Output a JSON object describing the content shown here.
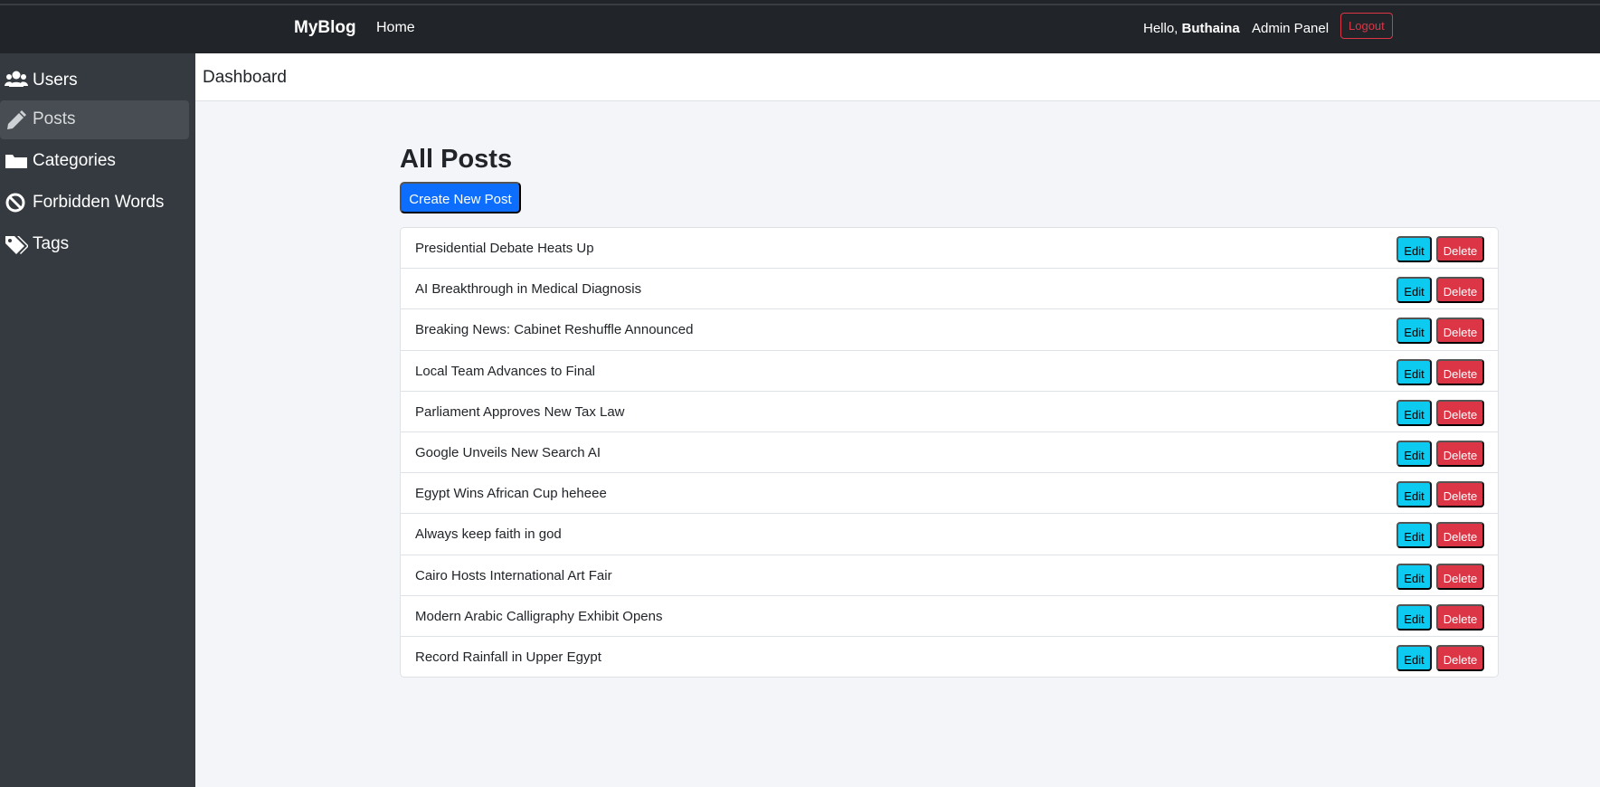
{
  "topbar": {
    "brand": "MyBlog",
    "home": "Home",
    "hello_prefix": "Hello,",
    "username": "Buthaina",
    "admin_panel": "Admin Panel",
    "logout": "Logout"
  },
  "sidebar": {
    "items": [
      {
        "label": "Users",
        "icon": "users-icon",
        "active": false
      },
      {
        "label": "Posts",
        "icon": "pencil-icon",
        "active": true
      },
      {
        "label": "Categories",
        "icon": "folder-icon",
        "active": false
      },
      {
        "label": "Forbidden Words",
        "icon": "ban-icon",
        "active": false
      },
      {
        "label": "Tags",
        "icon": "tags-icon",
        "active": false
      }
    ]
  },
  "header": {
    "title": "Dashboard"
  },
  "main": {
    "title": "All Posts",
    "create_button": "Create New Post",
    "edit_label": "Edit",
    "delete_label": "Delete",
    "posts": [
      "Presidential Debate Heats Up",
      "AI Breakthrough in Medical Diagnosis",
      "Breaking News: Cabinet Reshuffle Announced",
      "Local Team Advances to Final",
      "Parliament Approves New Tax Law",
      "Google Unveils New Search AI",
      "Egypt Wins African Cup heheee",
      "Always keep faith in god",
      "Cairo Hosts International Art Fair",
      "Modern Arabic Calligraphy Exhibit Opens",
      "Record Rainfall in Upper Egypt"
    ]
  },
  "colors": {
    "navbar": "#212529",
    "sidebar": "#343a40",
    "primary": "#0d6efd",
    "info": "#0dcaf0",
    "danger": "#dc3545"
  }
}
